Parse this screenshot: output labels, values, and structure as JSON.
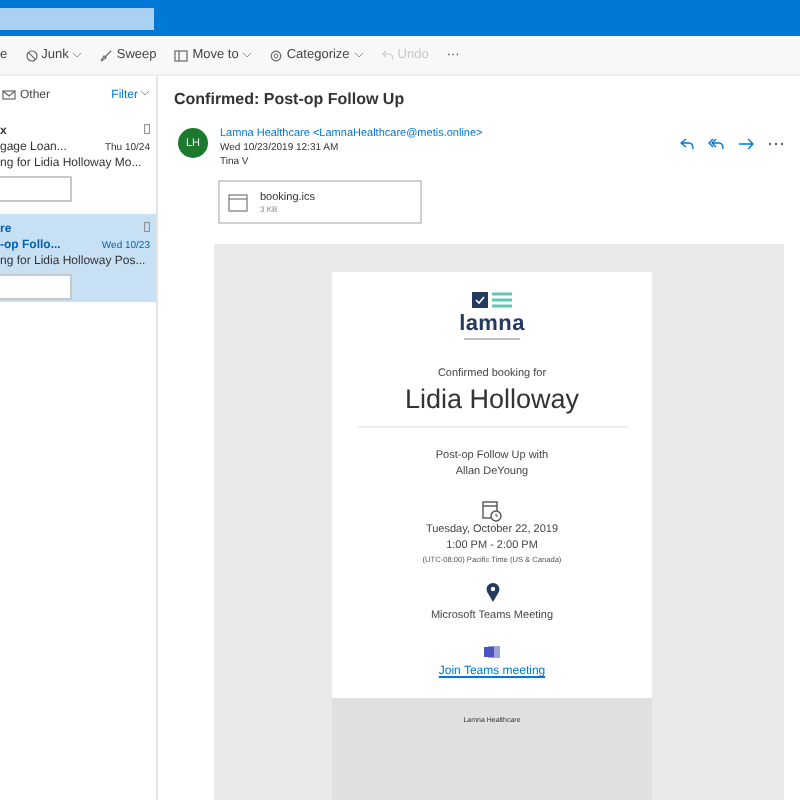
{
  "toolbar": {
    "items": [
      {
        "label": "e",
        "dropdown": false,
        "disabled": false
      },
      {
        "label": "Junk",
        "dropdown": true,
        "disabled": false
      },
      {
        "label": "Sweep",
        "dropdown": false,
        "disabled": false
      },
      {
        "label": "Move to",
        "dropdown": true,
        "disabled": false
      },
      {
        "label": "Categorize",
        "dropdown": true,
        "disabled": false
      },
      {
        "label": "Undo",
        "dropdown": false,
        "disabled": true
      },
      {
        "label": "···",
        "dropdown": false,
        "disabled": false
      }
    ]
  },
  "message_list": {
    "folder": "Other",
    "filter": "Filter",
    "messages": [
      {
        "sender": "x",
        "subject": "gage Loan...",
        "date": "Thu 10/24",
        "preview": "ng for Lidia Holloway Mo...",
        "selected": false
      },
      {
        "sender": "re",
        "subject": "-op Follo...",
        "date": "Wed 10/23",
        "preview": "ng for Lidia Holloway Pos...",
        "selected": true
      }
    ]
  },
  "reading_pane": {
    "subject": "Confirmed: Post-op Follow Up",
    "sender": {
      "initials": "LH",
      "name": "Lamna Healthcare <LamnaHealthcare@metis.online>",
      "date": "Wed 10/23/2019 12:31 AM",
      "to": "Tina V"
    },
    "attachment": {
      "name": "booking.ics",
      "size": "3 KB"
    },
    "email": {
      "logo": "lamna",
      "heading": "Confirmed booking for",
      "patient": "Lidia Holloway",
      "appointment": "Post-op Follow Up with",
      "provider": "Allan DeYoung",
      "date": "Tuesday, October 22, 2019",
      "time": "1:00 PM - 2:00 PM",
      "timezone": "(UTC-08:00) Pacific Time (US & Canada)",
      "location": "Microsoft Teams Meeting",
      "join_link": "Join Teams meeting",
      "footer": "Lamna Healthcare"
    }
  }
}
